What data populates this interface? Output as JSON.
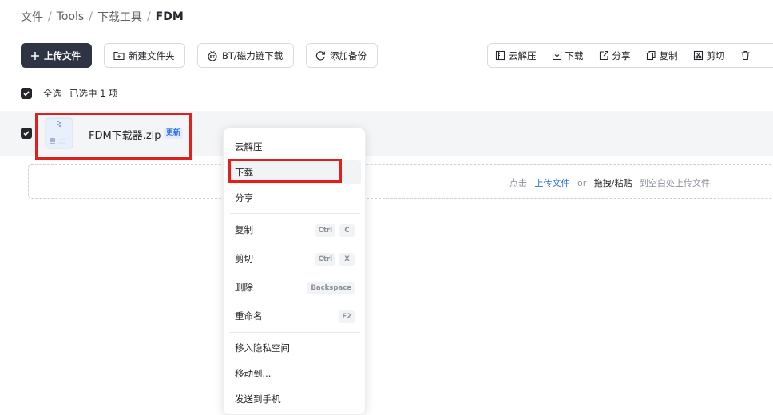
{
  "breadcrumb": {
    "items": [
      "文件",
      "Tools",
      "下载工具"
    ],
    "separator": "/",
    "current": "FDM"
  },
  "toolbar": {
    "upload_label": "上传文件",
    "new_folder_label": "新建文件夹",
    "bt_label": "BT/磁力链下载",
    "backup_label": "添加备份"
  },
  "actions": {
    "extract": "云解压",
    "download": "下载",
    "share": "分享",
    "copy": "复制",
    "cut": "剪切"
  },
  "selection": {
    "select_all_label": "全选",
    "selected_info": "已选中 1 项"
  },
  "file": {
    "name": "FDM下载器.zip",
    "badge": "更新"
  },
  "dropzone": {
    "prefix": "点击",
    "upload_link": "上传文件",
    "or": "or",
    "drag_paste": "拖拽/粘贴",
    "suffix": "到空白处上传文件"
  },
  "context_menu": {
    "extract": "云解压",
    "download": "下载",
    "share": "分享",
    "copy": "复制",
    "copy_keys": [
      "Ctrl",
      "C"
    ],
    "cut": "剪切",
    "cut_keys": [
      "Ctrl",
      "X"
    ],
    "delete": "删除",
    "delete_key": "Backspace",
    "rename": "重命名",
    "rename_key": "F2",
    "move_private": "移入隐私空间",
    "move_to": "移动到...",
    "send_phone": "发送到手机"
  },
  "colors": {
    "primary_button": "#2f3445",
    "link": "#2f6fe4",
    "highlight_box": "#e0201f",
    "row_bg": "#f4f5f7"
  }
}
